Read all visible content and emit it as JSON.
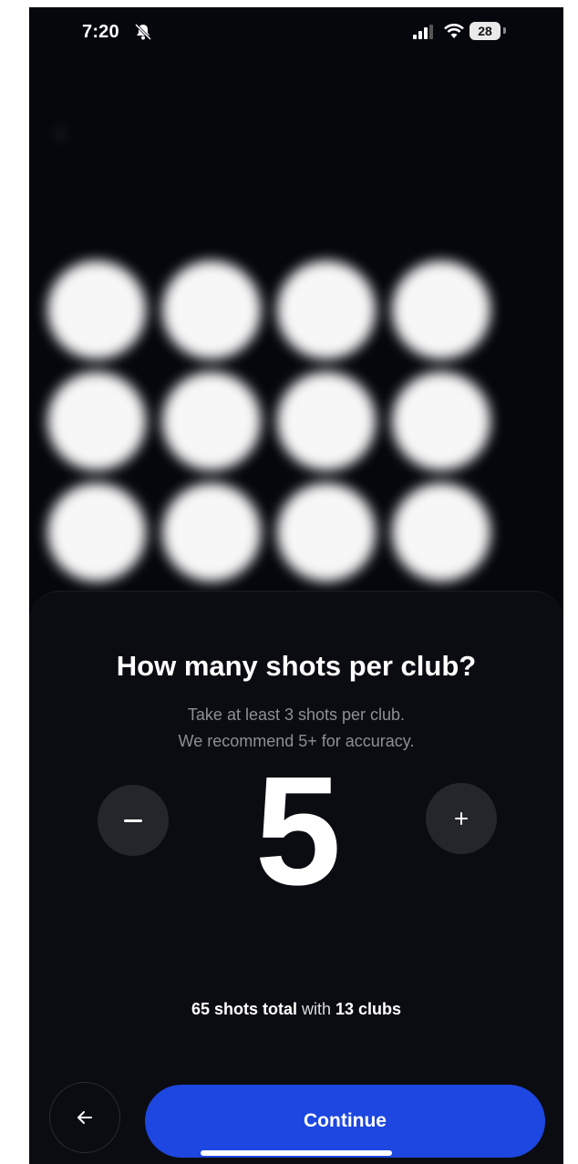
{
  "status_bar": {
    "time": "7:20",
    "battery": "28",
    "icons": [
      "bell-slash-icon",
      "signal-icon",
      "wifi-icon",
      "battery-icon"
    ]
  },
  "background": {
    "back_icon": "back-arrow-icon",
    "title": "",
    "subtitle": "",
    "clubs": [
      "",
      "",
      "",
      "",
      "",
      "",
      "",
      "",
      "",
      "",
      "",
      ""
    ]
  },
  "sheet": {
    "title": "How many shots per club?",
    "subtitle_line1": "Take at least 3 shots per club.",
    "subtitle_line2": "We recommend 5+ for accuracy.",
    "shots_per_club": "5",
    "decrement_icon": "minus-icon",
    "increment_icon": "plus-icon",
    "summary": {
      "total": "65 shots total",
      "middle": " with ",
      "clubs": "13 clubs"
    },
    "back_icon": "arrow-left-icon",
    "continue_label": "Continue"
  },
  "colors": {
    "background": "#05070d",
    "sheet": "#0b0c12",
    "stepper_button": "#25262c",
    "accent": "#1d47e0"
  }
}
